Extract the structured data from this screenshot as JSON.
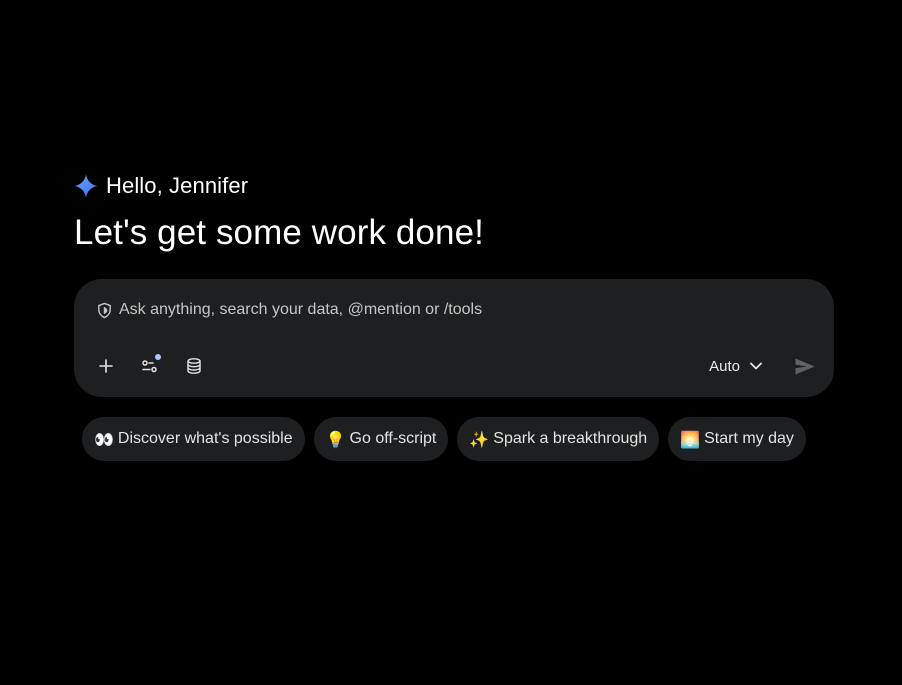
{
  "greeting": {
    "icon": "gemini-spark-icon",
    "text": "Hello, Jennifer",
    "accent_color": "#4c8df6"
  },
  "headline": "Let's get some work done!",
  "composer": {
    "shield_icon": "shield-icon",
    "placeholder": "Ask anything, search your data, @mention or /tools",
    "tools": [
      {
        "icon": "plus-icon",
        "label": "Add"
      },
      {
        "icon": "tools-icon",
        "label": "Tools"
      },
      {
        "icon": "database-icon",
        "label": "Data sources"
      }
    ],
    "model": "Auto",
    "model_icon": "chevron-down-icon",
    "send_icon": "send-icon"
  },
  "suggestions": [
    {
      "emoji": "👀",
      "label": "Discover what's possible"
    },
    {
      "emoji": "💡",
      "label": "Go off-script"
    },
    {
      "emoji": "✨",
      "label": "Spark a breakthrough"
    },
    {
      "emoji": "🌅",
      "label": "Start my day"
    }
  ],
  "colors": {
    "background": "#000000",
    "surface": "#1e1f20",
    "badge": "#a8c7fa"
  }
}
